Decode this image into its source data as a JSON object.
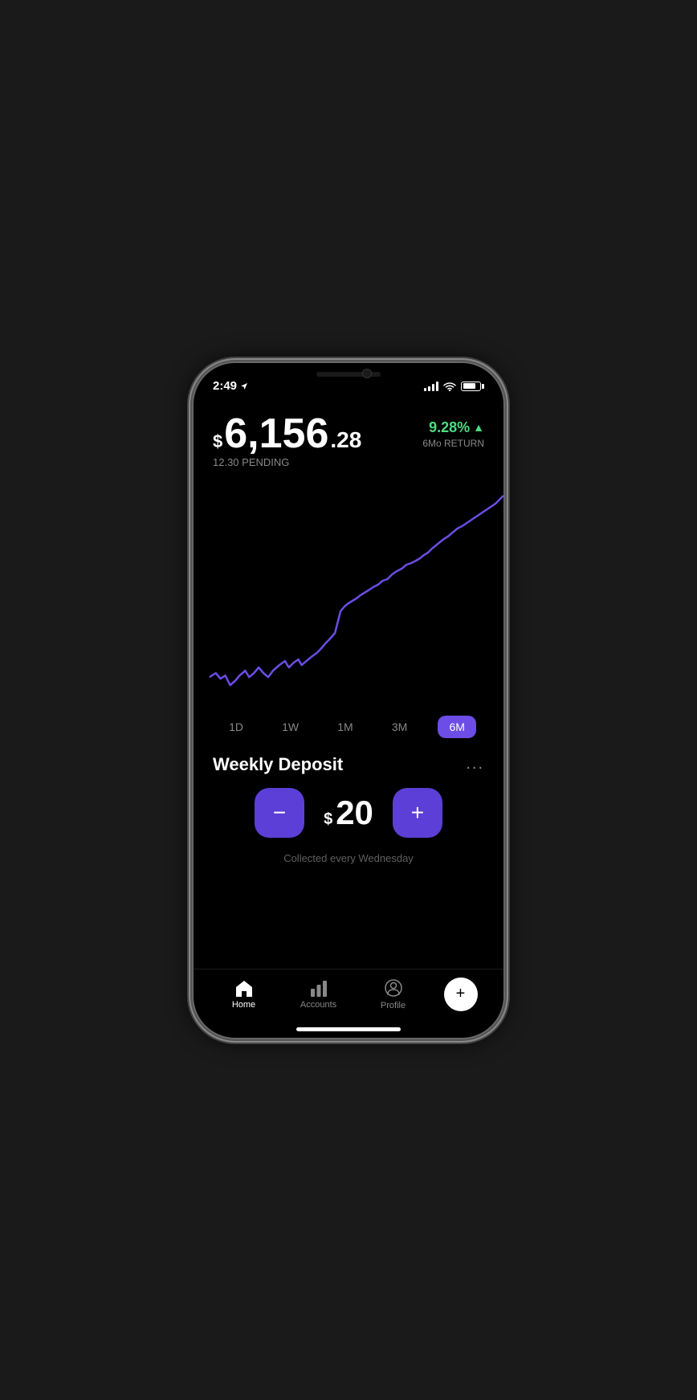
{
  "status_bar": {
    "time": "2:49",
    "location": true
  },
  "portfolio": {
    "currency_symbol": "$",
    "amount_main": "6,156",
    "amount_cents": ".28",
    "pending_label": "12.30 PENDING",
    "return_pct": "9.28%",
    "return_label": "6Mo RETURN"
  },
  "chart": {
    "selected_period": "6M"
  },
  "time_periods": [
    {
      "label": "1D",
      "active": false
    },
    {
      "label": "1W",
      "active": false
    },
    {
      "label": "1M",
      "active": false
    },
    {
      "label": "3M",
      "active": false
    },
    {
      "label": "6M",
      "active": true
    }
  ],
  "weekly_deposit": {
    "title": "Weekly Deposit",
    "amount_symbol": "$",
    "amount": "20",
    "collected_label": "Collected every Wednesday",
    "more_options_label": "..."
  },
  "controls": {
    "minus_label": "−",
    "plus_label": "+"
  },
  "bottom_nav": {
    "items": [
      {
        "label": "Home",
        "active": true,
        "icon": "home"
      },
      {
        "label": "Accounts",
        "active": false,
        "icon": "bar-chart"
      },
      {
        "label": "Profile",
        "active": false,
        "icon": "person-circle"
      }
    ],
    "add_button_label": "+"
  }
}
